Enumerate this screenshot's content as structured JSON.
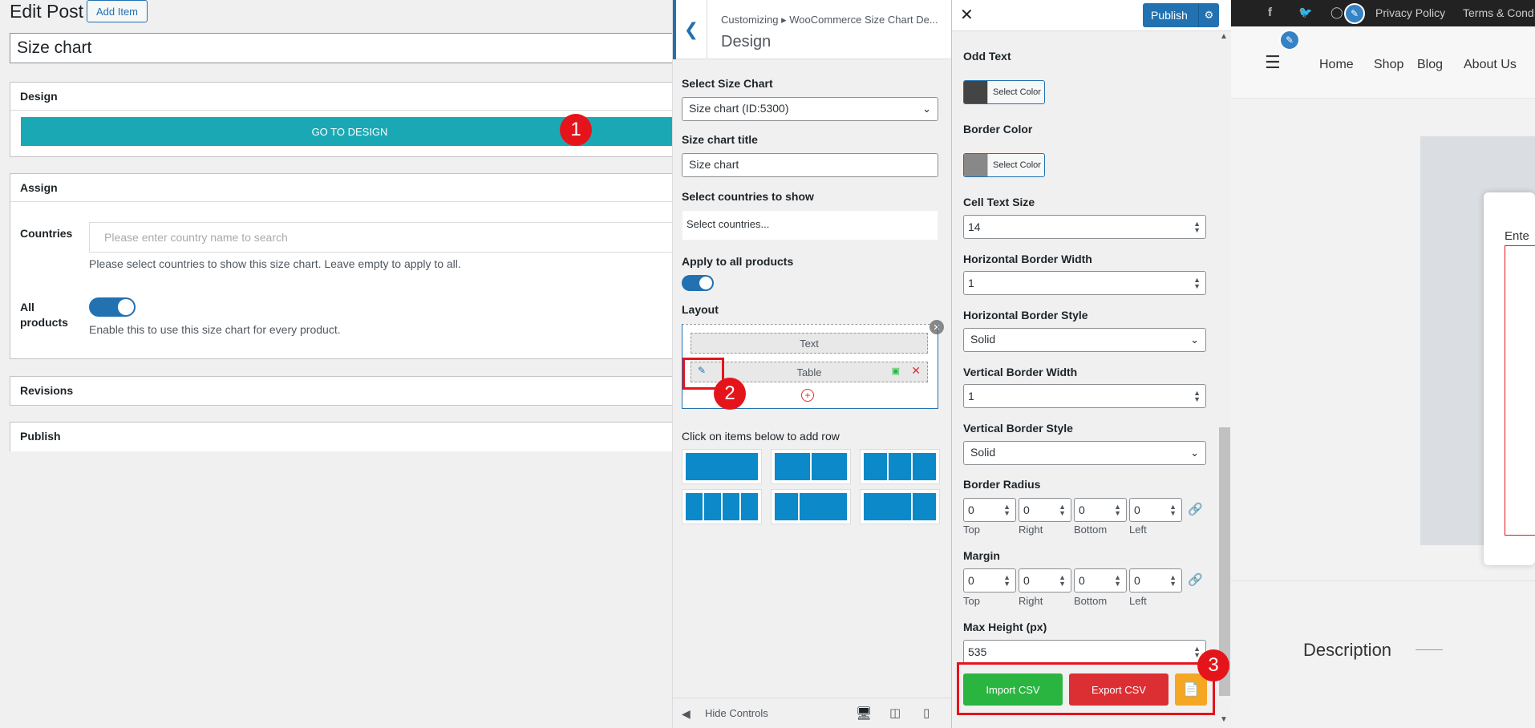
{
  "edit_post": {
    "heading": "Edit Post",
    "add_item": "Add Item",
    "title_value": "Size chart",
    "design_box": {
      "title": "Design",
      "go_button": "GO TO DESIGN"
    },
    "assign_box": {
      "title": "Assign",
      "countries_label": "Countries",
      "countries_placeholder": "Please enter country name to search",
      "countries_help": "Please select countries to show this size chart. Leave empty to apply to all.",
      "all_products_label_line1": "All",
      "all_products_label_line2": "products",
      "all_products_help": "Enable this to use this size chart for every product."
    },
    "revisions_title": "Revisions",
    "publish_title": "Publish"
  },
  "customizer_left": {
    "breadcrumb": "Customizing ▸ WooCommerce Size Chart De...",
    "section_title": "Design",
    "select_size_chart_label": "Select Size Chart",
    "select_size_chart_value": "Size chart (ID:5300)",
    "size_chart_title_label": "Size chart title",
    "size_chart_title_value": "Size chart",
    "countries_label": "Select countries to show",
    "countries_placeholder": "Select countries...",
    "apply_all_label": "Apply to all products",
    "layout_label": "Layout",
    "layout_rows": [
      "Text",
      "Table"
    ],
    "add_row_label": "Click on items below to add row",
    "row_presets": [
      [
        1
      ],
      [
        1,
        1
      ],
      [
        1,
        1,
        1
      ],
      [
        1,
        1,
        1,
        1
      ],
      [
        1,
        2
      ],
      [
        2,
        1
      ]
    ],
    "hide_controls": "Hide Controls"
  },
  "customizer_right": {
    "close_icon": "close-icon",
    "publish": "Publish",
    "odd_text_label": "Odd Text",
    "odd_text_color": "#444444",
    "border_color_label": "Border Color",
    "border_color_value": "#888888",
    "select_color": "Select Color",
    "cell_text_size_label": "Cell Text Size",
    "cell_text_size_value": "14",
    "h_border_width_label": "Horizontal Border Width",
    "h_border_width_value": "1",
    "h_border_style_label": "Horizontal Border Style",
    "h_border_style_value": "Solid",
    "v_border_width_label": "Vertical Border Width",
    "v_border_width_value": "1",
    "v_border_style_label": "Vertical Border Style",
    "v_border_style_value": "Solid",
    "border_radius_label": "Border Radius",
    "margin_label": "Margin",
    "side_labels": [
      "Top",
      "Right",
      "Bottom",
      "Left"
    ],
    "radius_values": [
      "0",
      "0",
      "0",
      "0"
    ],
    "margin_values": [
      "0",
      "0",
      "0",
      "0"
    ],
    "max_height_label": "Max Height (px)",
    "max_height_value": "535",
    "import_csv": "Import CSV",
    "export_csv": "Export CSV"
  },
  "preview": {
    "top_links": [
      "Privacy Policy",
      "Terms & Cond"
    ],
    "nav": [
      "Home",
      "Shop",
      "Blog",
      "About Us"
    ],
    "modal_text": "Ente",
    "description": "Description"
  },
  "annotations": [
    "1",
    "2",
    "3"
  ]
}
